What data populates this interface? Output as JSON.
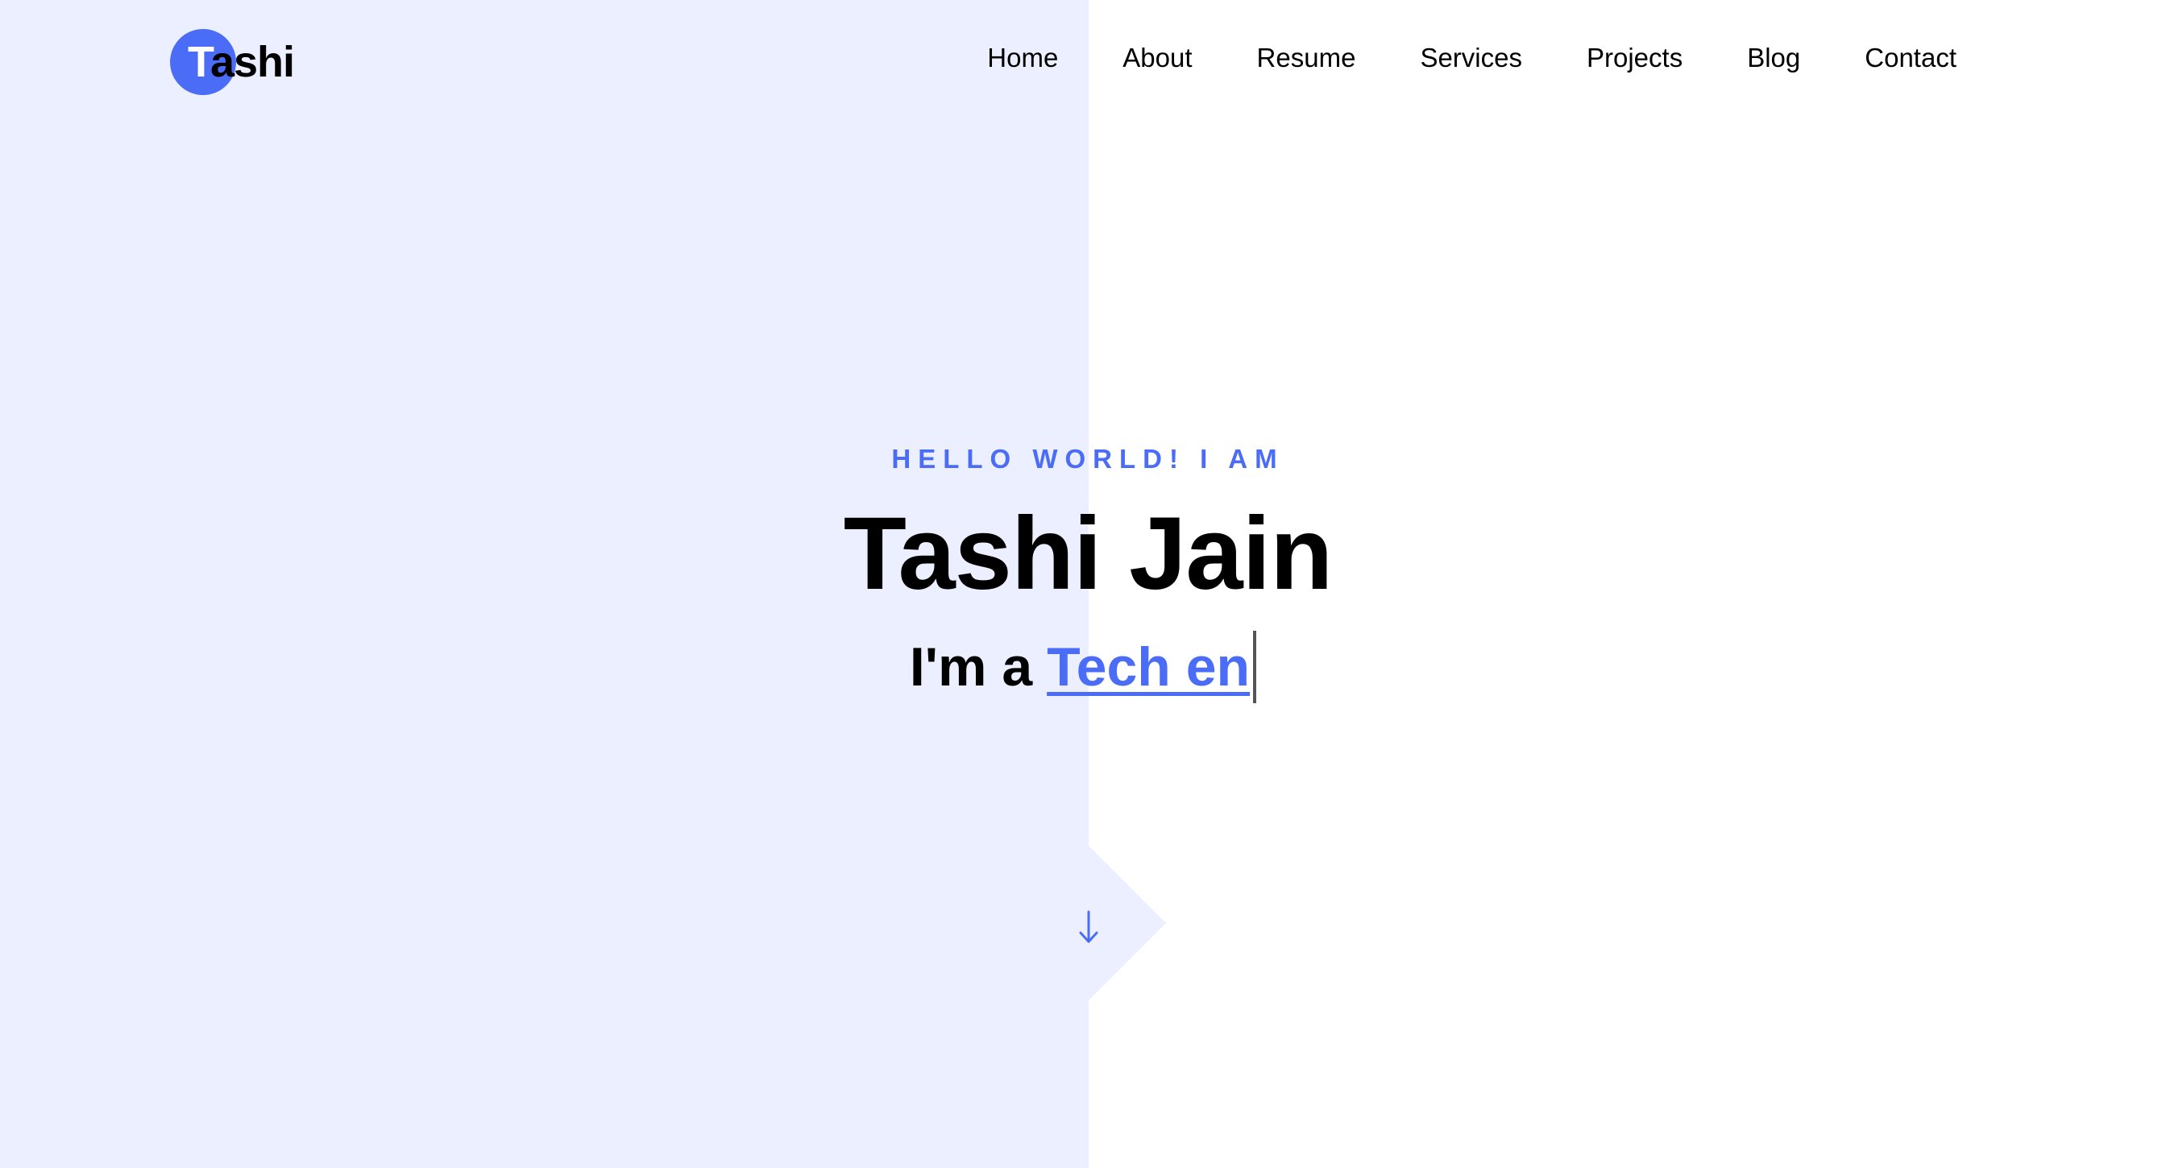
{
  "logo": {
    "first_letter": "T",
    "rest": "ashi"
  },
  "nav": {
    "items": [
      {
        "label": "Home"
      },
      {
        "label": "About"
      },
      {
        "label": "Resume"
      },
      {
        "label": "Services"
      },
      {
        "label": "Projects"
      },
      {
        "label": "Blog"
      },
      {
        "label": "Contact"
      }
    ]
  },
  "hero": {
    "greeting": "HELLO WORLD! I AM",
    "name": "Tashi Jain",
    "role_prefix": "I'm a",
    "role_typed": "Tech en"
  },
  "icons": {
    "scroll_down": "arrow-down-icon"
  },
  "colors": {
    "accent": "#4a6cf7",
    "left_panel": "#ecefff",
    "text": "#000000"
  }
}
